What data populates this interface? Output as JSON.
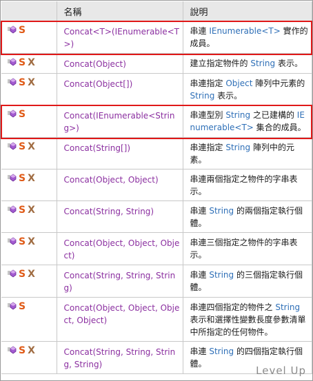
{
  "headers": {
    "icons": "",
    "name": "名稱",
    "description": "說明"
  },
  "rows": [
    {
      "icons": [
        "method",
        "static"
      ],
      "name": "Concat<T>(IEnumerable<T>)",
      "desc": [
        {
          "t": "串連 "
        },
        {
          "t": "IEnumerable<T>",
          "k": 1
        },
        {
          "t": " 實作的成員。"
        }
      ]
    },
    {
      "icons": [
        "method",
        "static",
        "xna"
      ],
      "name": "Concat(Object)",
      "desc": [
        {
          "t": "建立指定物件的 "
        },
        {
          "t": "String",
          "k": 1
        },
        {
          "t": " 表示。"
        }
      ]
    },
    {
      "icons": [
        "method",
        "static",
        "xna"
      ],
      "name": "Concat(Object[])",
      "desc": [
        {
          "t": "串連指定 "
        },
        {
          "t": "Object",
          "k": 1
        },
        {
          "t": " 陣列中元素的 "
        },
        {
          "t": "String",
          "k": 1
        },
        {
          "t": " 表示。"
        }
      ]
    },
    {
      "icons": [
        "method",
        "static"
      ],
      "name": "Concat(IEnumerable<String>)",
      "desc": [
        {
          "t": "串連型別 "
        },
        {
          "t": "String",
          "k": 1
        },
        {
          "t": " 之已建構的 "
        },
        {
          "t": "IEnumerable<T>",
          "k": 1
        },
        {
          "t": " 集合的成員。"
        }
      ]
    },
    {
      "icons": [
        "method",
        "static",
        "xna"
      ],
      "name": "Concat(String[])",
      "desc": [
        {
          "t": "串連指定 "
        },
        {
          "t": "String",
          "k": 1
        },
        {
          "t": " 陣列中的元素。"
        }
      ]
    },
    {
      "icons": [
        "method",
        "static",
        "xna"
      ],
      "name": "Concat(Object, Object)",
      "desc": [
        {
          "t": "串連兩個指定之物件的字串表示。"
        }
      ]
    },
    {
      "icons": [
        "method",
        "static",
        "xna"
      ],
      "name": "Concat(String, String)",
      "desc": [
        {
          "t": "串連 "
        },
        {
          "t": "String",
          "k": 1
        },
        {
          "t": " 的兩個指定執行個體。"
        }
      ]
    },
    {
      "icons": [
        "method",
        "static",
        "xna"
      ],
      "name": "Concat(Object, Object, Object)",
      "desc": [
        {
          "t": "串連三個指定之物件的字串表示。"
        }
      ]
    },
    {
      "icons": [
        "method",
        "static",
        "xna"
      ],
      "name": "Concat(String, String, String)",
      "desc": [
        {
          "t": "串連 "
        },
        {
          "t": "String",
          "k": 1
        },
        {
          "t": " 的三個指定執行個體。"
        }
      ]
    },
    {
      "icons": [
        "method",
        "static"
      ],
      "name": "Concat(Object, Object, Object, Object)",
      "desc": [
        {
          "t": "串連四個指定的物件之 "
        },
        {
          "t": "String",
          "k": 1
        },
        {
          "t": " 表示和選擇性變數長度參數清單中所指定的任何物件。"
        }
      ]
    },
    {
      "icons": [
        "method",
        "static",
        "xna"
      ],
      "name": "Concat(String, String, String, String)",
      "desc": [
        {
          "t": "串連 "
        },
        {
          "t": "String",
          "k": 1
        },
        {
          "t": " 的四個指定執行個體。"
        }
      ]
    }
  ],
  "icon_glyphs": {
    "static": "S",
    "xna": "X"
  },
  "colors": {
    "member_name": "#8b2fa0",
    "type_link": "#2e6fb7",
    "static_icon": "#e05a16",
    "xna_icon": "#a06c42",
    "method_icon": "#9b4fc4",
    "highlight": "#e01818",
    "header_bg": "#e8e8e8"
  },
  "highlighted_rows": [
    0,
    3
  ],
  "watermark": "Level Up"
}
